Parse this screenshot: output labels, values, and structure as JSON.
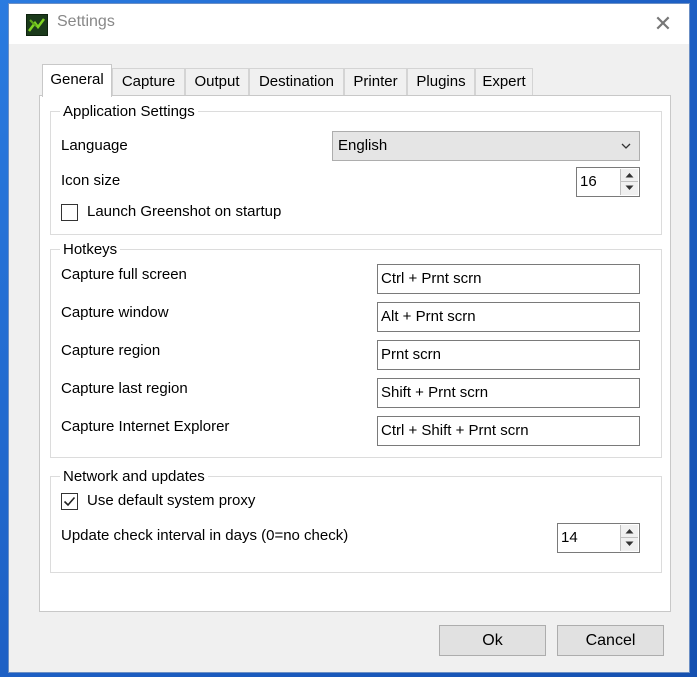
{
  "window": {
    "title": "Settings",
    "close_label": "✕"
  },
  "tabs": [
    {
      "label": "General",
      "active": true
    },
    {
      "label": "Capture",
      "active": false
    },
    {
      "label": "Output",
      "active": false
    },
    {
      "label": "Destination",
      "active": false
    },
    {
      "label": "Printer",
      "active": false
    },
    {
      "label": "Plugins",
      "active": false
    },
    {
      "label": "Expert",
      "active": false
    }
  ],
  "application_settings": {
    "legend": "Application Settings",
    "language_label": "Language",
    "language_value": "English",
    "icon_size_label": "Icon size",
    "icon_size_value": "16",
    "launch_label": "Launch Greenshot on startup",
    "launch_checked": false
  },
  "hotkeys": {
    "legend": "Hotkeys",
    "items": [
      {
        "label": "Capture full screen",
        "value": "Ctrl + Prnt scrn"
      },
      {
        "label": "Capture window",
        "value": "Alt + Prnt scrn"
      },
      {
        "label": "Capture region",
        "value": "Prnt scrn"
      },
      {
        "label": "Capture last region",
        "value": "Shift + Prnt scrn"
      },
      {
        "label": "Capture Internet Explorer",
        "value": "Ctrl + Shift + Prnt scrn"
      }
    ]
  },
  "network": {
    "legend": "Network and updates",
    "proxy_label": "Use default system proxy",
    "proxy_checked": true,
    "interval_label": "Update check interval in days (0=no check)",
    "interval_value": "14"
  },
  "buttons": {
    "ok": "Ok",
    "cancel": "Cancel"
  },
  "icons": {
    "app": "greenshot-app-icon",
    "close": "close-icon",
    "dropdown": "chevron-down-icon",
    "spin_up": "spin-up-icon",
    "spin_down": "spin-down-icon",
    "check": "checkmark-icon"
  }
}
